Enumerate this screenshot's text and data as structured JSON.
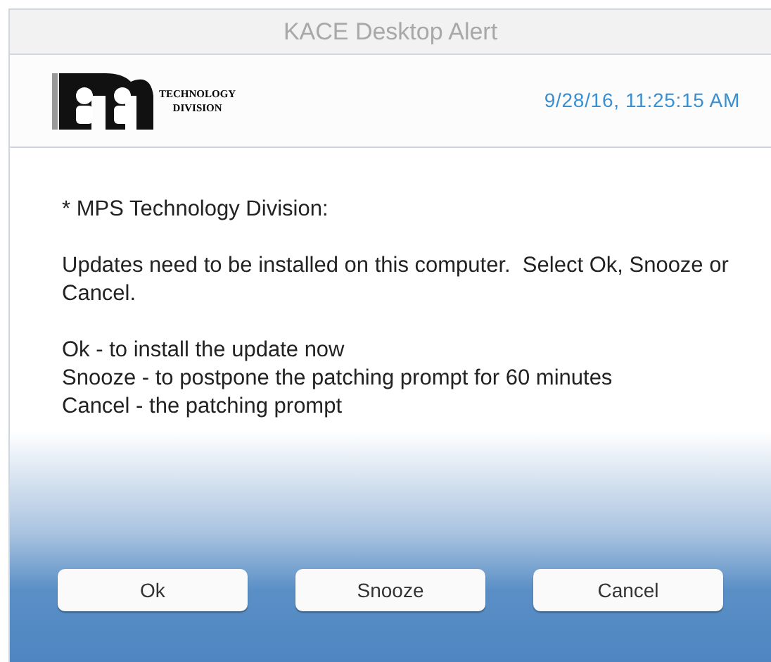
{
  "window": {
    "title": "KACE Desktop Alert"
  },
  "header": {
    "logo_text": [
      "TECHNOLOGY",
      "DIVISION"
    ],
    "timestamp": "9/28/16, 11:25:15 AM"
  },
  "message": {
    "heading": "* MPS Technology Division:",
    "paragraphs": [
      "Updates need to be installed on this computer.  Select Ok, Snooze or Cancel."
    ],
    "options": [
      "Ok - to install the update now",
      "Snooze - to postpone the patching prompt for 60 minutes",
      "Cancel - the patching prompt"
    ]
  },
  "buttons": [
    "Ok",
    "Snooze",
    "Cancel"
  ]
}
